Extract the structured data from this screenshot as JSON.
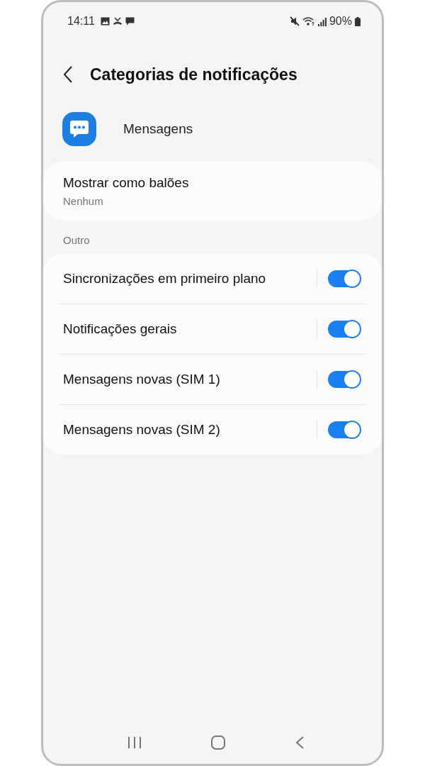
{
  "status_bar": {
    "time": "14:11",
    "battery": "90%"
  },
  "header": {
    "title": "Categorias de notificações"
  },
  "app": {
    "name": "Mensagens"
  },
  "bubbles": {
    "title": "Mostrar como balões",
    "value": "Nenhum"
  },
  "section": {
    "label": "Outro"
  },
  "toggles": [
    {
      "label": "Sincronizações em primeiro plano",
      "on": true
    },
    {
      "label": "Notificações gerais",
      "on": true
    },
    {
      "label": "Mensagens novas (SIM 1)",
      "on": true
    },
    {
      "label": "Mensagens novas (SIM 2)",
      "on": true
    }
  ]
}
